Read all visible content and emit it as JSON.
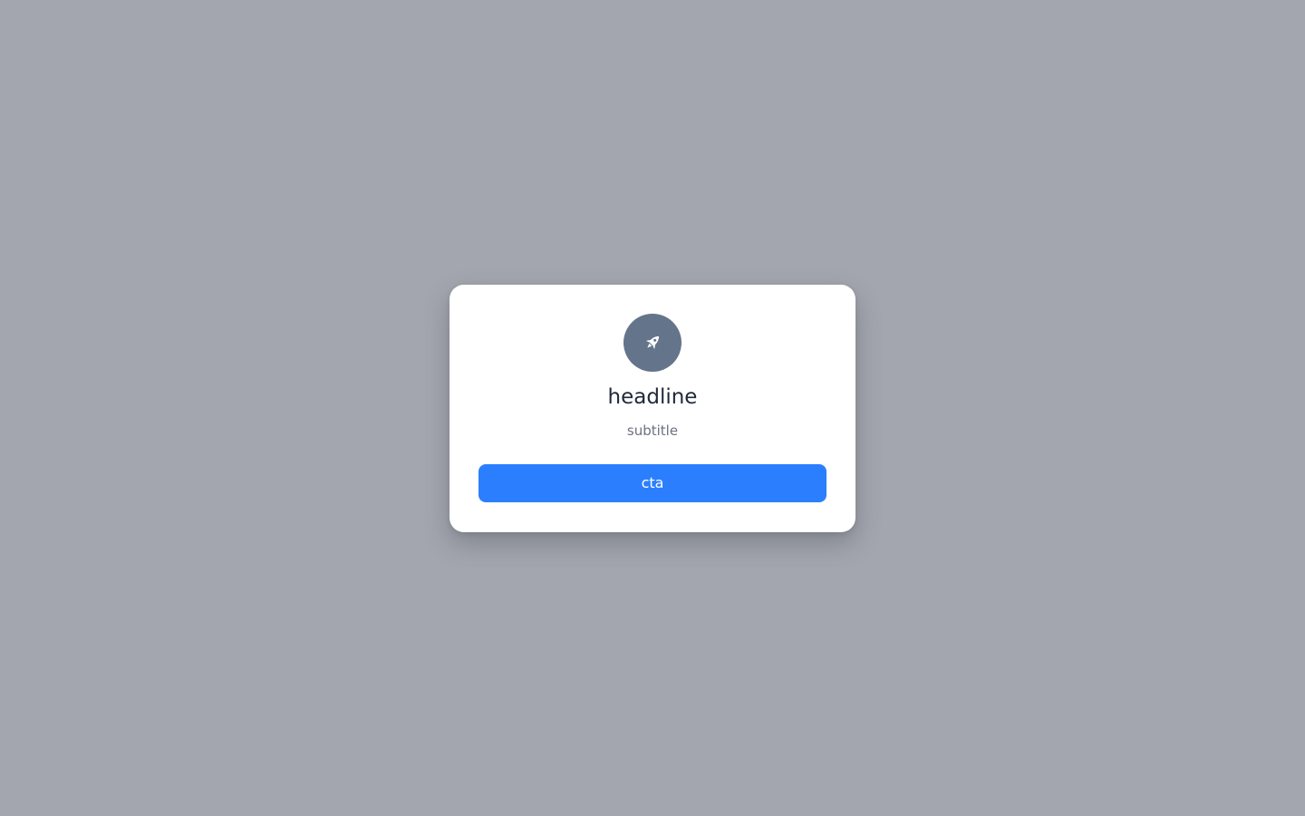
{
  "colors": {
    "page_background": "#a3a6ae",
    "modal_background": "#ffffff",
    "icon_circle": "#64748b",
    "accent": "#2b7fff",
    "headline_text": "#1f2937",
    "subtitle_text": "#6b7280"
  },
  "modal": {
    "icon": "rocket-icon",
    "headline": "headline",
    "subtitle": "subtitle",
    "cta_label": "cta"
  }
}
